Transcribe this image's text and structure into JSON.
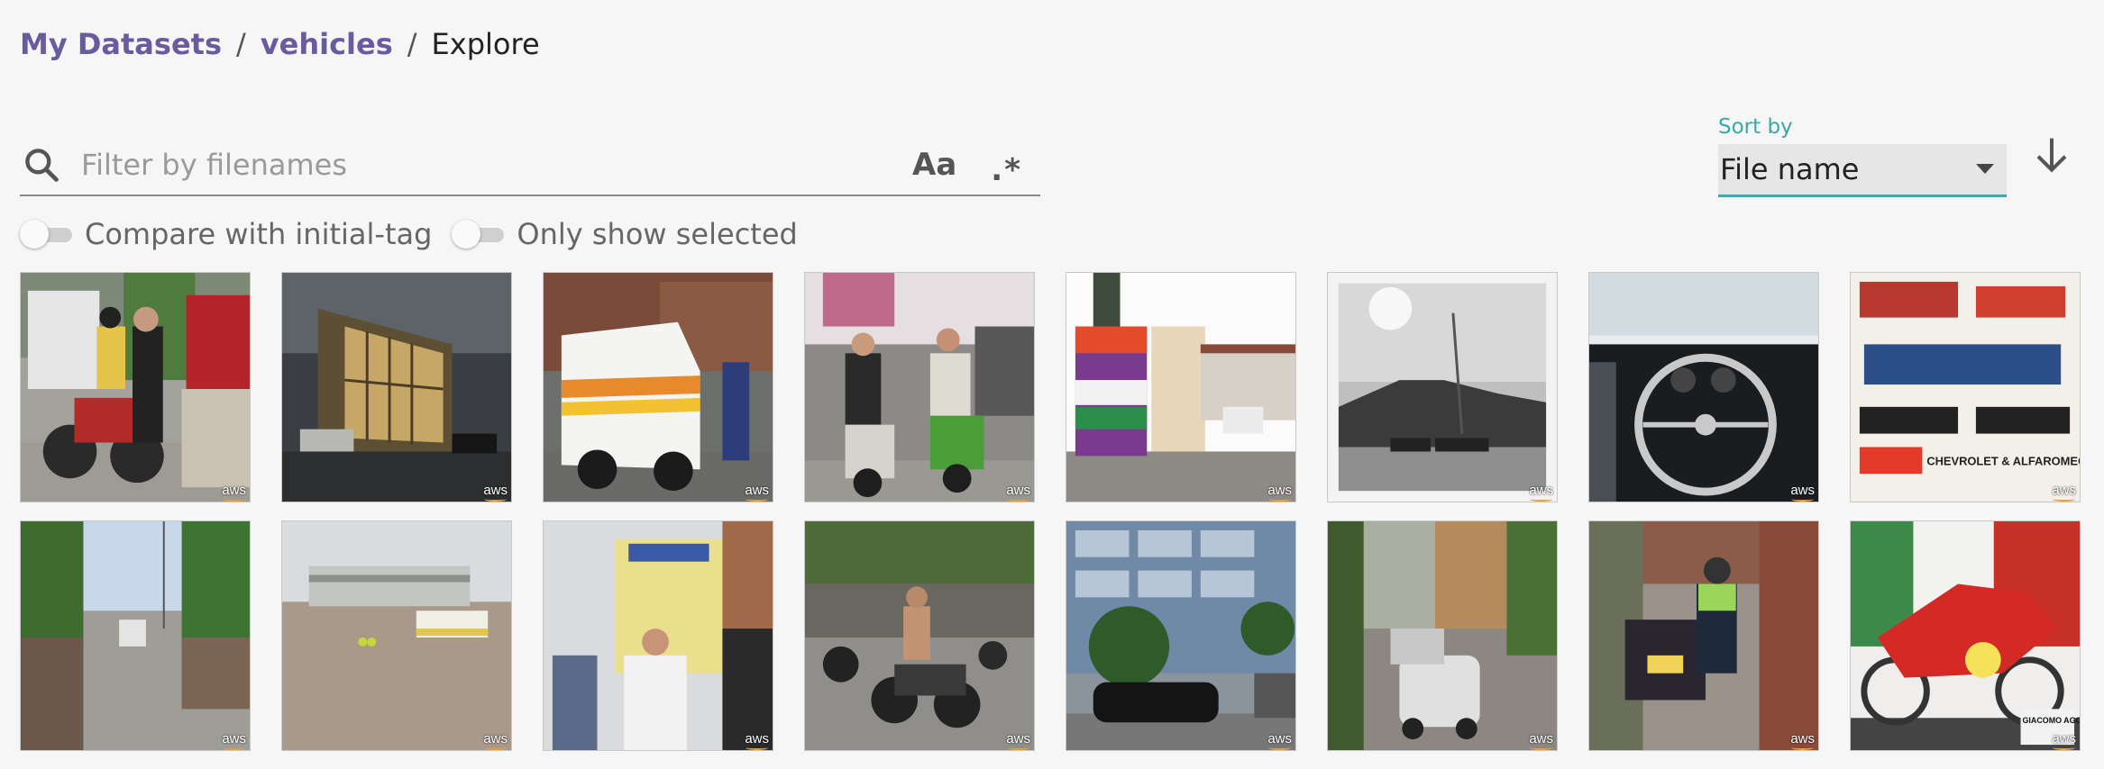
{
  "breadcrumb": {
    "items": [
      "My Datasets",
      "vehicles"
    ],
    "separator": "/",
    "current": "Explore"
  },
  "filter": {
    "placeholder": "Filter by filenames",
    "case_label": "Aa",
    "regex_label": ".*"
  },
  "toggles": {
    "compare_label": "Compare with initial-tag",
    "selected_label": "Only show selected"
  },
  "sort": {
    "caption": "Sort by",
    "value": "File name"
  },
  "colors": {
    "accent": "#43a9a8",
    "link": "#6a5a9e"
  },
  "tiles": [
    {
      "name": "thumb-motorcycle-riders",
      "badge": "aws"
    },
    {
      "name": "thumb-glass-building-night",
      "badge": "aws"
    },
    {
      "name": "thumb-ambulance",
      "badge": "aws"
    },
    {
      "name": "thumb-scooter-riders",
      "badge": "aws"
    },
    {
      "name": "thumb-street-billboard",
      "badge": "aws"
    },
    {
      "name": "thumb-grayscale-hill",
      "badge": "aws"
    },
    {
      "name": "thumb-car-dashboard",
      "badge": "aws"
    },
    {
      "name": "thumb-car-advertisement",
      "badge": "aws",
      "caption": "CHEVROLET & ALFAROMEO"
    },
    {
      "name": "thumb-parade-street",
      "badge": "aws"
    },
    {
      "name": "thumb-airport-bus",
      "badge": "aws"
    },
    {
      "name": "thumb-food-truck",
      "badge": "aws"
    },
    {
      "name": "thumb-motorbike-crowd",
      "badge": "aws"
    },
    {
      "name": "thumb-office-building-car",
      "badge": "aws"
    },
    {
      "name": "thumb-parked-cars-street",
      "badge": "aws"
    },
    {
      "name": "thumb-police-motorcycle",
      "badge": "aws"
    },
    {
      "name": "thumb-red-race-motorcycle",
      "badge": "aws",
      "caption": "GIACOMO AGOSTINI"
    }
  ]
}
